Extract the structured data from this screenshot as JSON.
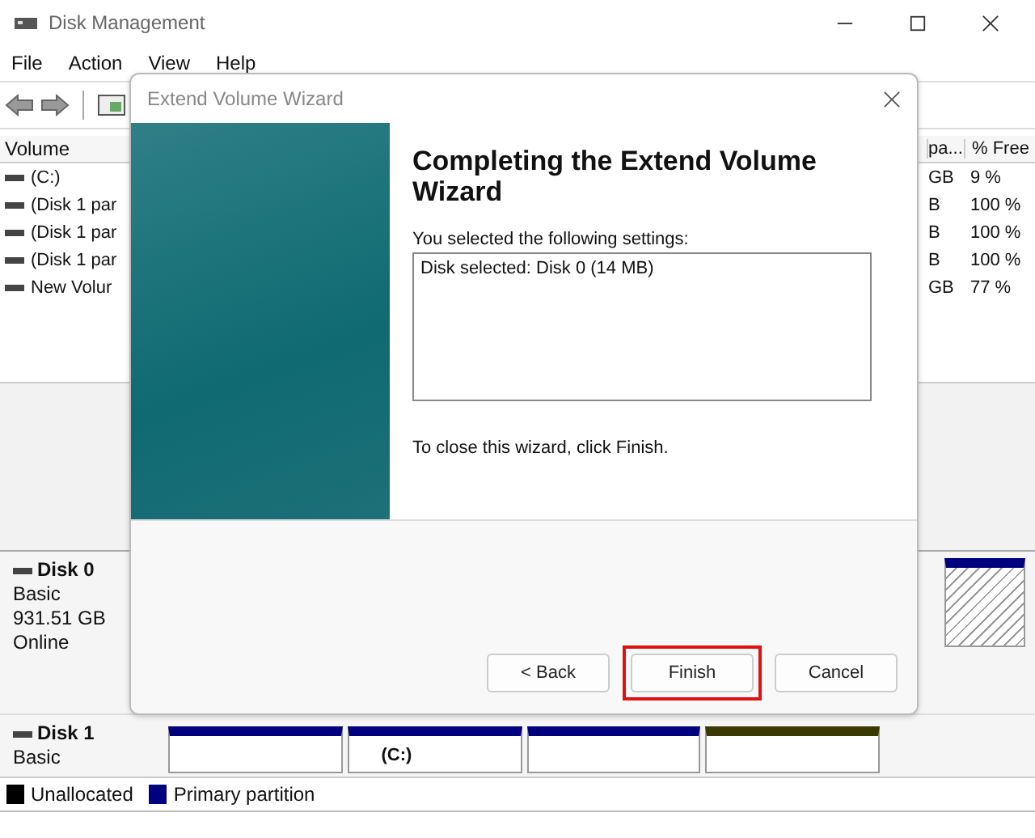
{
  "window": {
    "title": "Disk Management",
    "menu": [
      "File",
      "Action",
      "View",
      "Help"
    ]
  },
  "volume_list": {
    "columns": [
      "Volume",
      "pa...",
      "% Free"
    ],
    "rows": [
      {
        "volume": "(C:)",
        "capacity": "GB",
        "free": "9 %"
      },
      {
        "volume": "(Disk 1 par",
        "capacity": "B",
        "free": "100 %"
      },
      {
        "volume": "(Disk 1 par",
        "capacity": "B",
        "free": "100 %"
      },
      {
        "volume": "(Disk 1 par",
        "capacity": "B",
        "free": "100 %"
      },
      {
        "volume": "New Volur",
        "capacity": "GB",
        "free": "77 %"
      }
    ]
  },
  "disks": [
    {
      "name": "Disk 0",
      "lines": [
        "Basic",
        "931.51 GB",
        "Online"
      ],
      "partitions": [
        {
          "color": "#00007f",
          "kind": "hatched"
        }
      ]
    },
    {
      "name": "Disk 1",
      "lines": [
        "Basic"
      ],
      "partitions": [
        {
          "color": "#00007f",
          "kind": "plain"
        },
        {
          "color": "#00007f",
          "kind": "plain",
          "label": "(C:)"
        },
        {
          "color": "#00007f",
          "kind": "plain"
        },
        {
          "color": "#3a3a00",
          "kind": "plain"
        }
      ]
    }
  ],
  "legend": [
    {
      "label": "Unallocated",
      "color": "#000000"
    },
    {
      "label": "Primary partition",
      "color": "#00007f"
    }
  ],
  "dialog": {
    "title": "Extend Volume Wizard",
    "heading": "Completing the Extend Volume Wizard",
    "intro": "You selected the following settings:",
    "settings": [
      "Disk selected: Disk 0 (14 MB)"
    ],
    "closing": "To close this wizard, click Finish.",
    "buttons": [
      {
        "label": "< Back",
        "highlighted": false
      },
      {
        "label": "Finish",
        "highlighted": true
      },
      {
        "label": "Cancel",
        "highlighted": false
      }
    ]
  }
}
